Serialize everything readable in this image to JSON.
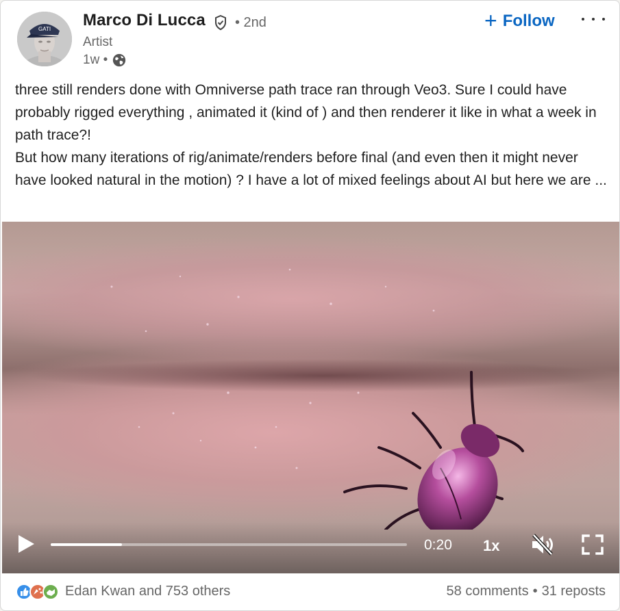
{
  "author": {
    "name": "Marco Di Lucca",
    "degree": "• 2nd",
    "headline": "Artist",
    "time": "1w •",
    "avatar_cap_text": "GATI"
  },
  "actions": {
    "follow_label": "Follow",
    "follow_icon": "plus-icon",
    "more_icon": "ellipsis-icon"
  },
  "post": {
    "paragraphs": [
      "three still renders done with Omniverse path trace ran through Veo3. Sure I could have probably rigged everything , animated it (kind of ) and then renderer it like in what a week in path trace?!",
      "But how many iterations of rig/animate/renders before final (and even then it might never have looked natural in the motion) ? I have a lot of mixed feelings about AI but here we are ..."
    ]
  },
  "video": {
    "time": "0:20",
    "speed": "1x",
    "progress": 0.2,
    "muted": true
  },
  "social": {
    "reactions_label": "Edan Kwan and 753 others",
    "comments": "58 comments",
    "separator": "•",
    "reposts": "31 reposts"
  },
  "colors": {
    "accent": "#0a66c2",
    "text": "#1f1f1f",
    "muted": "#666666",
    "like": "#378fe9",
    "celebrate": "#df704d",
    "support": "#6dae4f"
  }
}
